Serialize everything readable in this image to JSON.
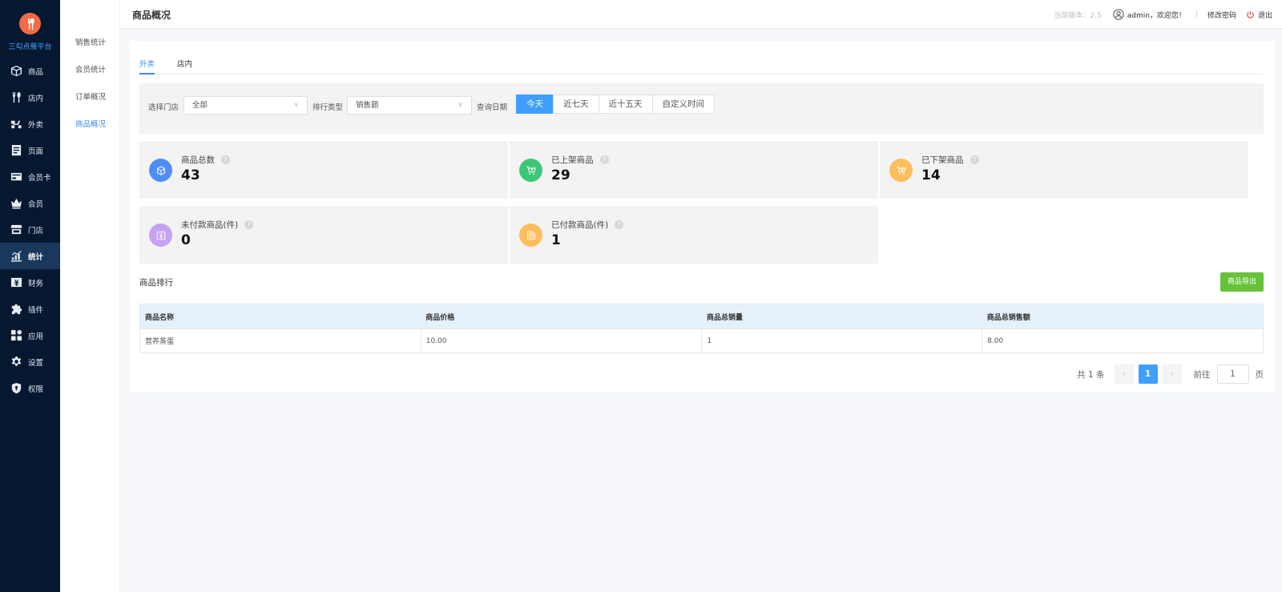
{
  "brand": {
    "name": "三勾点餐平台"
  },
  "nav": [
    {
      "label": "商品",
      "icon": "box-icon"
    },
    {
      "label": "店内",
      "icon": "utensils-icon"
    },
    {
      "label": "外卖",
      "icon": "scooter-icon"
    },
    {
      "label": "页面",
      "icon": "page-icon"
    },
    {
      "label": "会员卡",
      "icon": "card-icon"
    },
    {
      "label": "会员",
      "icon": "crown-icon"
    },
    {
      "label": "门店",
      "icon": "store-icon"
    },
    {
      "label": "统计",
      "icon": "chart-icon",
      "active": true
    },
    {
      "label": "财务",
      "icon": "finance-icon"
    },
    {
      "label": "插件",
      "icon": "puzzle-icon"
    },
    {
      "label": "应用",
      "icon": "apps-icon"
    },
    {
      "label": "设置",
      "icon": "gear-icon"
    },
    {
      "label": "权限",
      "icon": "shield-icon"
    }
  ],
  "subnav": [
    {
      "label": "销售统计"
    },
    {
      "label": "会员统计"
    },
    {
      "label": "订单概况"
    },
    {
      "label": "商品概况",
      "active": true
    }
  ],
  "header": {
    "title": "商品概况",
    "version": "当前版本：2.5",
    "user": "admin，欢迎您！",
    "separator": "|",
    "change_password": "修改密码",
    "logout": "退出"
  },
  "tabs": [
    {
      "label": "外卖",
      "active": true
    },
    {
      "label": "店内"
    }
  ],
  "filter": {
    "store_label": "选择门店",
    "store_value": "全部",
    "rank_label": "排行类型",
    "rank_value": "销售额",
    "date_label": "查询日期",
    "date_options": [
      "今天",
      "近七天",
      "近十五天",
      "自定义时间"
    ],
    "date_selected": "今天"
  },
  "stats": [
    {
      "label": "商品总数",
      "value": "43",
      "icon": "cube-icon",
      "color": "#4f8ef7"
    },
    {
      "label": "已上架商品",
      "value": "29",
      "icon": "cart-up-icon",
      "color": "#3cc777"
    },
    {
      "label": "已下架商品",
      "value": "14",
      "icon": "cart-down-icon",
      "color": "#ffbe5c"
    },
    {
      "label": "未付款商品(件)",
      "value": "0",
      "icon": "yen-icon",
      "color": "#c7a2f2"
    },
    {
      "label": "已付款商品(件)",
      "value": "1",
      "icon": "paid-icon",
      "color": "#ffbe5c"
    }
  ],
  "ranking": {
    "title": "商品排行",
    "export_label": "商品导出",
    "columns": [
      "商品名称",
      "商品价格",
      "商品总销量",
      "商品总销售额"
    ],
    "rows": [
      [
        "营养蒸蛋",
        "10.00",
        "1",
        "8.00"
      ]
    ]
  },
  "pagination": {
    "total": "共 1 条",
    "prev": "‹",
    "current": "1",
    "next": "›",
    "goto_label": "前往",
    "goto_value": "1",
    "page_suffix": "页"
  },
  "colors": {
    "nav_bg": "#061830",
    "accent": "#409eff",
    "export": "#67c23a",
    "logo": "#f26b45"
  }
}
